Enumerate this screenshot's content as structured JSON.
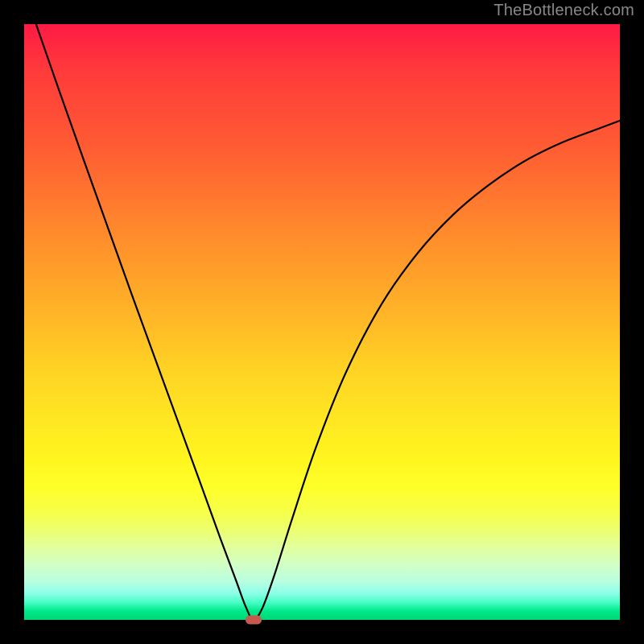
{
  "watermark": "TheBottleneck.com",
  "chart_data": {
    "type": "line",
    "title": "",
    "xlabel": "",
    "ylabel": "",
    "xlim": [
      0,
      1
    ],
    "ylim": [
      0,
      1
    ],
    "background_gradient": {
      "top": "#ff1a44",
      "mid": "#ffe622",
      "bottom": "#00d876"
    },
    "marker": {
      "x": 0.385,
      "y": 0.0,
      "color": "#c65a4e"
    },
    "series": [
      {
        "name": "curve",
        "color": "#000000",
        "x": [
          0.02,
          0.06,
          0.1,
          0.14,
          0.18,
          0.22,
          0.26,
          0.3,
          0.33,
          0.355,
          0.372,
          0.385,
          0.4,
          0.42,
          0.45,
          0.49,
          0.54,
          0.6,
          0.66,
          0.72,
          0.78,
          0.84,
          0.9,
          0.96,
          1.0
        ],
        "y": [
          1.0,
          0.885,
          0.772,
          0.66,
          0.548,
          0.438,
          0.328,
          0.218,
          0.135,
          0.068,
          0.022,
          0.0,
          0.02,
          0.075,
          0.17,
          0.29,
          0.415,
          0.53,
          0.615,
          0.68,
          0.73,
          0.77,
          0.8,
          0.823,
          0.838
        ]
      }
    ]
  }
}
